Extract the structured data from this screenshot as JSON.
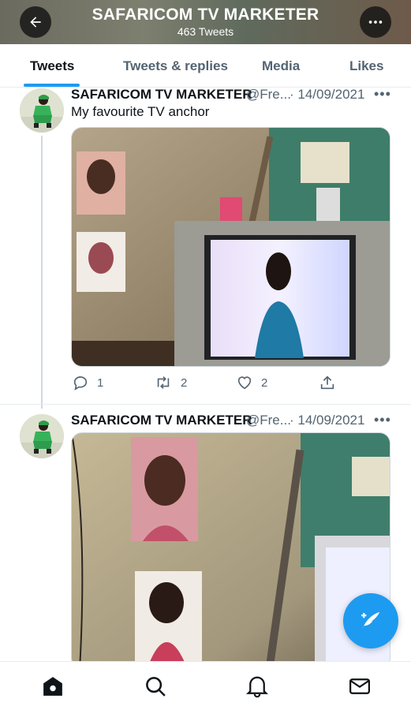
{
  "header": {
    "title": "SAFARICOM TV MARKETER",
    "subtitle": "463 Tweets",
    "back_icon": "arrow-left-icon",
    "more_icon": "more-horizontal-icon"
  },
  "tabs": [
    {
      "label": "Tweets",
      "active": true
    },
    {
      "label": "Tweets & replies",
      "active": false
    },
    {
      "label": "Media",
      "active": false
    },
    {
      "label": "Likes",
      "active": false
    }
  ],
  "tweets": [
    {
      "name": "SAFARICOM TV MARKETER",
      "handle": "@Fre...",
      "date": "· 14/09/2021",
      "text": "My favourite TV anchor",
      "actions": {
        "replies": "1",
        "retweets": "2",
        "likes": "2"
      }
    },
    {
      "name": "SAFARICOM TV MARKETER",
      "handle": "@Fre...",
      "date": "· 14/09/2021",
      "text": ""
    }
  ],
  "colors": {
    "accent": "#1d9bf0",
    "text": "#0f1419",
    "muted": "#536471"
  },
  "bottom_nav": [
    {
      "icon": "home-icon"
    },
    {
      "icon": "search-icon"
    },
    {
      "icon": "bell-icon"
    },
    {
      "icon": "mail-icon"
    }
  ]
}
